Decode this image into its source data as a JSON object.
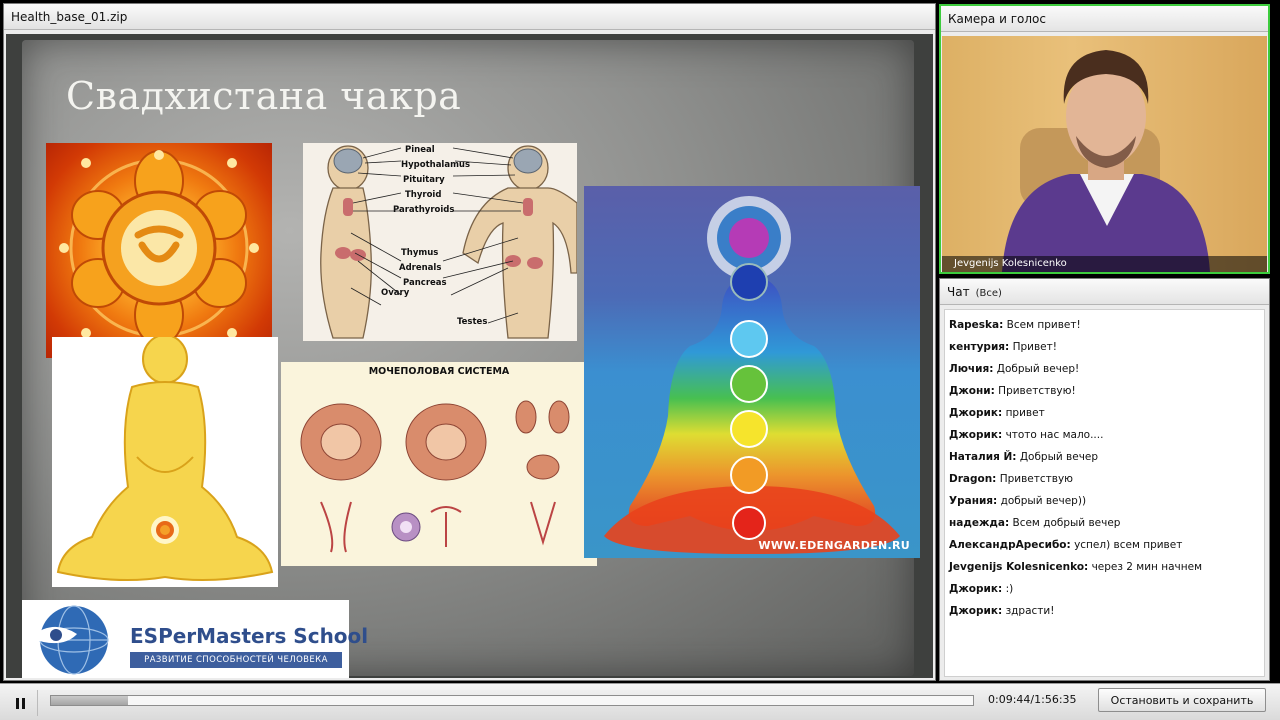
{
  "share": {
    "title": "Health_base_01.zip",
    "slide": {
      "title": "Свадхистана чакра",
      "endocrine_labels": [
        "Pineal",
        "Hypothalamus",
        "Pituitary",
        "Thyroid",
        "Parathyroids",
        "Thymus",
        "Adrenals",
        "Pancreas",
        "Ovary",
        "Testes"
      ],
      "uro_title": "МОЧЕПОЛОВАЯ СИСТЕМА",
      "chakra_watermark": "WWW.EDENGARDEN.RU",
      "logo_name": "ESPerMasters School",
      "logo_tagline": "РАЗВИТИЕ СПОСОБНОСТЕЙ ЧЕЛОВЕКА"
    }
  },
  "camera": {
    "title": "Камера и голос",
    "presenter": "Jevgenijs Kolesnicenko"
  },
  "chat": {
    "title": "Чат",
    "scope": "(Все)",
    "messages": [
      {
        "user": "Rapeska:",
        "text": "Всем привет!"
      },
      {
        "user": "кентурия:",
        "text": "Привет!"
      },
      {
        "user": "Лючия:",
        "text": "Добрый вечер!"
      },
      {
        "user": "Джони:",
        "text": "Приветствую!"
      },
      {
        "user": "Джорик:",
        "text": "привет"
      },
      {
        "user": "Джорик:",
        "text": "чтото нас мало...."
      },
      {
        "user": "Наталия Й:",
        "text": "Добрый вечер"
      },
      {
        "user": "Dragon:",
        "text": "Приветствую"
      },
      {
        "user": "Урания:",
        "text": "добрый вечер))"
      },
      {
        "user": "надежда:",
        "text": "Всем добрый вечер"
      },
      {
        "user": "АлександрАресибо:",
        "text": "успел) всем привет"
      },
      {
        "user": "Jevgenijs Kolesnicenko:",
        "text": "через 2 мин начнем"
      },
      {
        "user": "Джорик:",
        "text": ":)"
      },
      {
        "user": "Джорик:",
        "text": "здрасти!"
      }
    ]
  },
  "playback": {
    "time": "0:09:44/1:56:35",
    "progress": 0.0835,
    "stop_label": "Остановить и сохранить"
  },
  "colors": {
    "active_pod_border": "#3dcc3d",
    "logo_blue": "#2f4e8c"
  },
  "icons": {
    "pause": "pause-icon"
  }
}
